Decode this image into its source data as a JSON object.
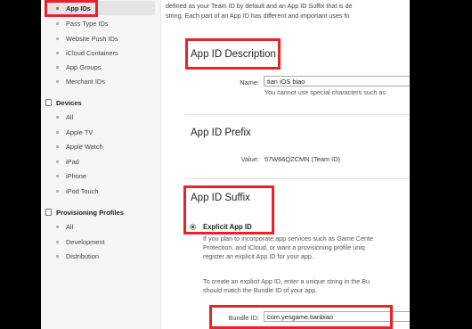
{
  "sidebar": {
    "identifiers": [
      {
        "label": "App IDs",
        "active": true
      },
      {
        "label": "Pass Type IDs"
      },
      {
        "label": "Website Push IDs"
      },
      {
        "label": "iCloud Containers"
      },
      {
        "label": "App Groups"
      },
      {
        "label": "Merchant IDs"
      }
    ],
    "devices_header": "Devices",
    "devices": [
      "All",
      "Apple TV",
      "Apple Watch",
      "iPad",
      "iPhone",
      "iPod Touch"
    ],
    "profiles_header": "Provisioning Profiles",
    "profiles": [
      "All",
      "Development",
      "Distribution"
    ]
  },
  "intro": {
    "line1": "defined as your Team ID by default and an App ID Suffix that is de",
    "line2": "string. Each part of an App ID has different and important uses fo"
  },
  "description": {
    "title": "App ID Description",
    "name_label": "Name:",
    "name_value": "tian iOS biao",
    "hint": "You cannot use special characters such as"
  },
  "prefix": {
    "title": "App ID Prefix",
    "value_label": "Value:",
    "value": "57W66QZCMN (Team ID)"
  },
  "suffix": {
    "title": "App ID Suffix",
    "explicit_label": "Explicit App ID",
    "para1": [
      "If you plan to incorporate app services such as Game Cente",
      "Protection, and iCloud, or want a provisioning profile uniq",
      "register an explicit App ID for your app."
    ],
    "para2": [
      "To create an explicit App ID, enter a unique string in the Bu",
      "should match the Bundle ID of your app."
    ],
    "bundle_label": "Bundle ID:",
    "bundle_value": "com.yesgame.tianbiao"
  },
  "colors": {
    "highlight": "#e8232b",
    "sidebar_bg": "#f6f6f6",
    "background": "#000000"
  }
}
